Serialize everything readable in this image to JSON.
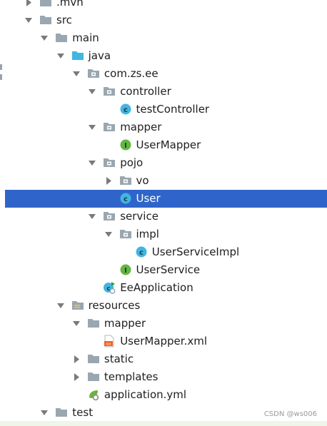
{
  "tree": [
    {
      "depth": 0,
      "arrow": "right",
      "icon": "folder",
      "label": ".mvn",
      "partial": true
    },
    {
      "depth": 0,
      "arrow": "down",
      "icon": "folder",
      "label": "src"
    },
    {
      "depth": 1,
      "arrow": "down",
      "icon": "folder",
      "label": "main"
    },
    {
      "depth": 2,
      "arrow": "down",
      "icon": "folder-source",
      "label": "java"
    },
    {
      "depth": 3,
      "arrow": "down",
      "icon": "package",
      "label": "com.zs.ee"
    },
    {
      "depth": 4,
      "arrow": "down",
      "icon": "package",
      "label": "controller"
    },
    {
      "depth": 5,
      "arrow": "none",
      "icon": "class",
      "label": "testController"
    },
    {
      "depth": 4,
      "arrow": "down",
      "icon": "package",
      "label": "mapper"
    },
    {
      "depth": 5,
      "arrow": "none",
      "icon": "interface",
      "label": "UserMapper"
    },
    {
      "depth": 4,
      "arrow": "down",
      "icon": "package",
      "label": "pojo"
    },
    {
      "depth": 5,
      "arrow": "right",
      "icon": "package",
      "label": "vo"
    },
    {
      "depth": 5,
      "arrow": "none",
      "icon": "class",
      "label": "User",
      "selected": true
    },
    {
      "depth": 4,
      "arrow": "down",
      "icon": "package",
      "label": "service"
    },
    {
      "depth": 5,
      "arrow": "down",
      "icon": "package",
      "label": "impl"
    },
    {
      "depth": 6,
      "arrow": "none",
      "icon": "class",
      "label": "UserServiceImpl"
    },
    {
      "depth": 5,
      "arrow": "none",
      "icon": "interface",
      "label": "UserService"
    },
    {
      "depth": 4,
      "arrow": "none",
      "icon": "spring-class",
      "label": "EeApplication"
    },
    {
      "depth": 2,
      "arrow": "down",
      "icon": "folder-resources",
      "label": "resources"
    },
    {
      "depth": 3,
      "arrow": "down",
      "icon": "folder",
      "label": "mapper"
    },
    {
      "depth": 4,
      "arrow": "none",
      "icon": "xml-file",
      "label": "UserMapper.xml"
    },
    {
      "depth": 3,
      "arrow": "right",
      "icon": "folder",
      "label": "static"
    },
    {
      "depth": 3,
      "arrow": "right",
      "icon": "folder",
      "label": "templates"
    },
    {
      "depth": 3,
      "arrow": "none",
      "icon": "yml-file",
      "label": "application.yml"
    },
    {
      "depth": 1,
      "arrow": "down",
      "icon": "folder",
      "label": "test"
    }
  ],
  "watermark": "CSDN @ws006",
  "colors": {
    "selection": "#2f65ca",
    "arrow": "#7a7a7a",
    "folder": "#9aa7b0",
    "source_folder": "#40b6e0",
    "class": "#40b6e0",
    "interface": "#62b543",
    "xml": "#f26522",
    "spring": "#6db33f"
  }
}
